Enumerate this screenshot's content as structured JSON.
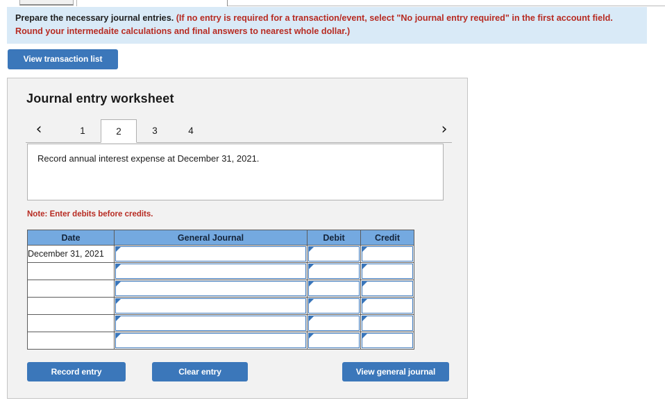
{
  "banner": {
    "main_text": "Prepare the necessary journal entries.",
    "paren_text": "(If no entry is required for a transaction/event, select \"No journal entry required\" in the first account field. Round your intermedaite calculations and final answers to nearest whole dollar.)"
  },
  "toolbar": {
    "view_transaction_list_label": "View transaction list"
  },
  "panel": {
    "title": "Journal entry worksheet",
    "pager": {
      "prev_icon": "chevron-left-icon",
      "next_icon": "chevron-right-icon",
      "prev_glyph": "‹",
      "next_glyph": "›",
      "items": [
        {
          "label": "1",
          "active": false
        },
        {
          "label": "2",
          "active": true
        },
        {
          "label": "3",
          "active": false
        },
        {
          "label": "4",
          "active": false
        }
      ]
    },
    "description": "Record annual interest expense at December 31, 2021.",
    "note": "Note: Enter debits before credits."
  },
  "table": {
    "headers": [
      "Date",
      "General Journal",
      "Debit",
      "Credit"
    ],
    "rows": [
      {
        "date": "December 31, 2021",
        "general_journal": "",
        "debit": "",
        "credit": ""
      },
      {
        "date": "",
        "general_journal": "",
        "debit": "",
        "credit": ""
      },
      {
        "date": "",
        "general_journal": "",
        "debit": "",
        "credit": ""
      },
      {
        "date": "",
        "general_journal": "",
        "debit": "",
        "credit": ""
      },
      {
        "date": "",
        "general_journal": "",
        "debit": "",
        "credit": ""
      },
      {
        "date": "",
        "general_journal": "",
        "debit": "",
        "credit": ""
      }
    ]
  },
  "actions": {
    "record_entry_label": "Record entry",
    "clear_entry_label": "Clear entry",
    "view_general_journal_label": "View general journal"
  },
  "colors": {
    "button_blue": "#3b77ba",
    "table_header_blue": "#74a9e0",
    "banner_bg": "#d9eaf7",
    "alert_red": "#b72b22",
    "panel_bg": "#f2f2f2",
    "field_border_blue": "#3a76ba"
  }
}
